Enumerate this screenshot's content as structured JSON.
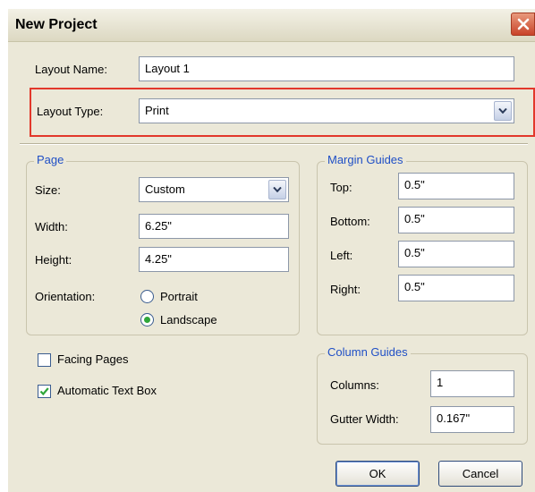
{
  "window": {
    "title": "New Project"
  },
  "layout_name": {
    "label": "Layout Name:",
    "value": "Layout 1"
  },
  "layout_type": {
    "label": "Layout Type:",
    "value": "Print"
  },
  "page": {
    "title": "Page",
    "size": {
      "label": "Size:",
      "value": "Custom"
    },
    "width": {
      "label": "Width:",
      "value": "6.25\""
    },
    "height": {
      "label": "Height:",
      "value": "4.25\""
    },
    "orientation": {
      "label": "Orientation:",
      "portrait": "Portrait",
      "landscape": "Landscape",
      "selected": "Landscape"
    }
  },
  "margin_guides": {
    "title": "Margin Guides",
    "top": {
      "label": "Top:",
      "value": "0.5\""
    },
    "bottom": {
      "label": "Bottom:",
      "value": "0.5\""
    },
    "left": {
      "label": "Left:",
      "value": "0.5\""
    },
    "right": {
      "label": "Right:",
      "value": "0.5\""
    }
  },
  "options": {
    "facing_pages": {
      "label": "Facing Pages",
      "checked": false
    },
    "automatic_text_box": {
      "label": "Automatic Text Box",
      "checked": true
    }
  },
  "column_guides": {
    "title": "Column Guides",
    "columns": {
      "label": "Columns:",
      "value": "1"
    },
    "gutter_width": {
      "label": "Gutter Width:",
      "value": "0.167\""
    }
  },
  "buttons": {
    "ok": "OK",
    "cancel": "Cancel"
  },
  "colors": {
    "accent_red": "#e2382b",
    "group_title_blue": "#1f4fc6",
    "dialog_bg": "#ebe8d8"
  }
}
